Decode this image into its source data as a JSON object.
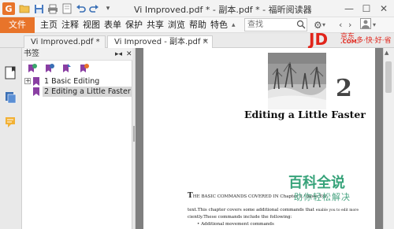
{
  "titlebar": {
    "title": "Vi Improved.pdf * - 副本.pdf * - 福昕阅读器"
  },
  "menubar": {
    "file": "文件",
    "items": [
      "主页",
      "注释",
      "视图",
      "表单",
      "保护",
      "共享",
      "浏览",
      "帮助",
      "特色"
    ],
    "search_placeholder": "查找"
  },
  "tabs": [
    {
      "label": "Vi Improved.pdf *",
      "active": false
    },
    {
      "label": "Vi Improved - 副本.pdf *",
      "active": true
    }
  ],
  "bookmarks": {
    "header": "书签",
    "items": [
      {
        "label": "1 Basic Editing",
        "expandable": true,
        "selected": false
      },
      {
        "label": "2 Editing a Little Faster",
        "expandable": false,
        "selected": true
      }
    ]
  },
  "document": {
    "chapter_number": "2",
    "chapter_title": "Editing a Little Faster",
    "line1_cap": "T",
    "line1": "HE BASIC COMMANDS COVERED IN Chapter 1,\"Basic Edi",
    "line2": "text.This chapter covers some additional commands that",
    "line2b": "enable you to edit more",
    "line3": "ciently.These commands include the following:",
    "bullets": [
      "Additional movement commands"
    ]
  },
  "ad": {
    "logo": "JD",
    "cn": "京东",
    "com": ".COM",
    "slogan": "多·快·好·省"
  },
  "watermark": {
    "title": "百科全说",
    "subtitle": "助你轻松解决"
  },
  "colors": {
    "accent": "#e8742a",
    "jd_red": "#e1251b",
    "watermark_green": "#37a37a",
    "selection": "#d7d7d7"
  }
}
